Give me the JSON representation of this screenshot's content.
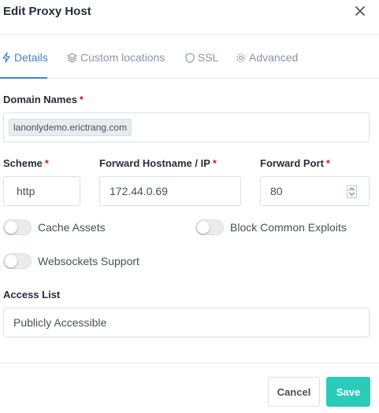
{
  "header": {
    "title": "Edit Proxy Host"
  },
  "tabs": [
    {
      "label": "Details",
      "icon": "lightning-icon"
    },
    {
      "label": "Custom locations",
      "icon": "layers-icon"
    },
    {
      "label": "SSL",
      "icon": "shield-icon"
    },
    {
      "label": "Advanced",
      "icon": "gear-icon"
    }
  ],
  "form": {
    "domain_names": {
      "label": "Domain Names",
      "value": "lanonlydemo.erictrang.com"
    },
    "scheme": {
      "label": "Scheme",
      "value": "http"
    },
    "forward_host": {
      "label": "Forward Hostname / IP",
      "value": "172.44.0.69"
    },
    "forward_port": {
      "label": "Forward Port",
      "value": "80"
    },
    "required_mark": "*",
    "toggles": {
      "cache_assets": {
        "label": "Cache Assets",
        "on": false
      },
      "block_exploits": {
        "label": "Block Common Exploits",
        "on": false
      },
      "websockets": {
        "label": "Websockets Support",
        "on": false
      }
    },
    "access_list": {
      "label": "Access List",
      "value": "Publicly Accessible"
    }
  },
  "footer": {
    "cancel_label": "Cancel",
    "save_label": "Save"
  },
  "colors": {
    "accent": "#467fcf",
    "save": "#2bcbba",
    "required": "#cd201f"
  }
}
